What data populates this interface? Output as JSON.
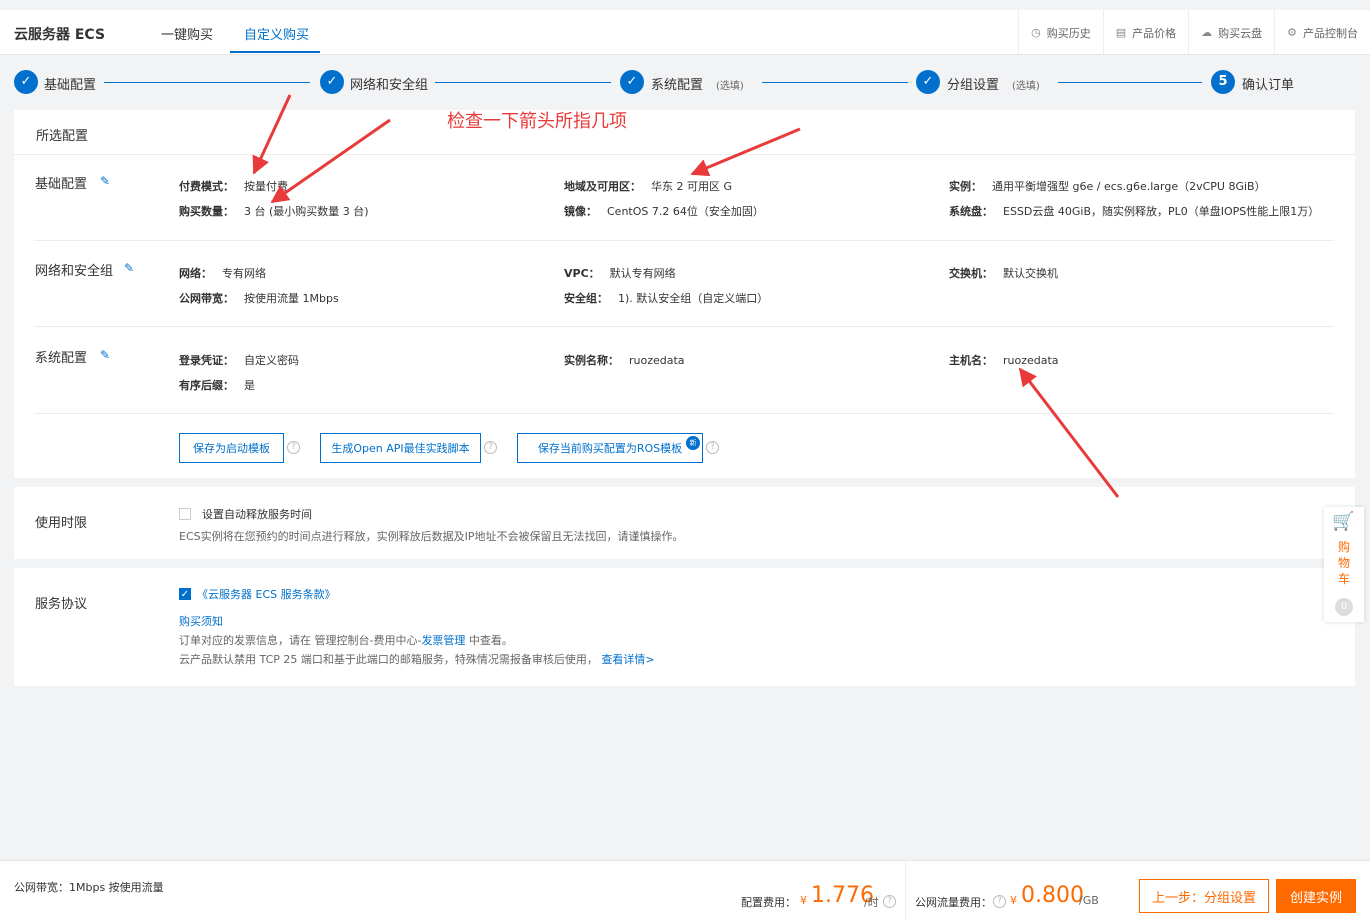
{
  "header": {
    "brand": "云服务器 ECS",
    "tabs": [
      {
        "label": "一键购买"
      },
      {
        "label": "自定义购买"
      }
    ],
    "links": [
      {
        "icon": "clock-icon",
        "label": "购买历史"
      },
      {
        "icon": "document-icon",
        "label": "产品价格"
      },
      {
        "icon": "cloud-disk-icon",
        "label": "购买云盘"
      },
      {
        "icon": "gear-icon",
        "label": "产品控制台"
      }
    ]
  },
  "steps": [
    {
      "label": "基础配置",
      "sub": ""
    },
    {
      "label": "网络和安全组",
      "sub": ""
    },
    {
      "label": "系统配置",
      "sub": "(选填)"
    },
    {
      "label": "分组设置",
      "sub": "(选填)"
    },
    {
      "label": "确认订单",
      "sub": "",
      "number": "5"
    }
  ],
  "annotation": "检查一下箭头所指几项",
  "selected": {
    "title": "所选配置",
    "basic": {
      "label": "基础配置",
      "billing_key": "付费模式：",
      "billing_val": "按量付费",
      "count_key": "购买数量：",
      "count_val": "3 台 (最小购买数量 3 台)",
      "region_key": "地域及可用区：",
      "region_val": "华东 2 可用区 G",
      "image_key": "镜像：",
      "image_val": "CentOS 7.2 64位（安全加固）",
      "instance_key": "实例：",
      "instance_val": "通用平衡增强型 g6e / ecs.g6e.large（2vCPU 8GiB）",
      "disk_key": "系统盘：",
      "disk_val": "ESSD云盘 40GiB，随实例释放，PL0（单盘IOPS性能上限1万）"
    },
    "network": {
      "label": "网络和安全组",
      "net_key": "网络：",
      "net_val": "专有网络",
      "vpc_key": "VPC：",
      "vpc_val": "默认专有网络",
      "switch_key": "交换机：",
      "switch_val": "默认交换机",
      "bw_key": "公网带宽：",
      "bw_val": "按使用流量 1Mbps",
      "sg_key": "安全组：",
      "sg_val": "1). 默认安全组（自定义端口）"
    },
    "system": {
      "label": "系统配置",
      "login_key": "登录凭证：",
      "login_val": "自定义密码",
      "name_key": "实例名称：",
      "name_val": "ruozedata",
      "host_key": "主机名：",
      "host_val": "ruozedata",
      "suffix_key": "有序后缀：",
      "suffix_val": "是"
    },
    "buttons": {
      "save_template": "保存为启动模板",
      "gen_api": "生成Open API最佳实践脚本",
      "save_ros": "保存当前购买配置为ROS模板",
      "new_badge": "新"
    }
  },
  "duration": {
    "label": "使用时限",
    "checkbox_label": "设置自动释放服务时间",
    "note": "ECS实例将在您预约的时间点进行释放，实例释放后数据及IP地址不会被保留且无法找回，请谨慎操作。"
  },
  "agreement": {
    "label": "服务协议",
    "terms": "《云服务器 ECS 服务条款》",
    "purchase_notice": "购买须知",
    "invoice_pre": "订单对应的发票信息，请在 管理控制台-费用中心-",
    "invoice_link": "发票管理",
    "invoice_post": " 中查看。",
    "tcp_note": "云产品默认禁用 TCP 25 端口和基于此端口的邮箱服务，特殊情况需报备审核后使用，",
    "tcp_link": "查看详情>"
  },
  "cart": {
    "label": "购物车",
    "count": "0"
  },
  "footer": {
    "bandwidth": "公网带宽：1Mbps 按使用流量",
    "config_fee_label": "配置费用：",
    "config_currency": "¥",
    "config_price": "1.776",
    "config_unit": "/时",
    "traffic_fee_label": "公网流量费用：",
    "traffic_currency": "¥",
    "traffic_price": "0.800",
    "traffic_unit": "/GB",
    "prev_button": "上一步：分组设置",
    "create_button": "创建实例"
  },
  "colors": {
    "accent": "#0070cc",
    "orange": "#ff6a00",
    "annotation": "#e83a3a"
  }
}
